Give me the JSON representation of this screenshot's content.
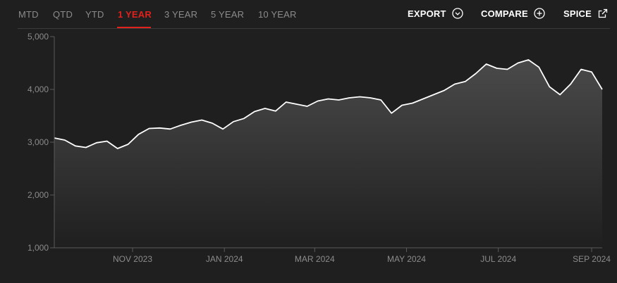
{
  "toolbar": {
    "tabs": [
      {
        "label": "MTD",
        "active": false
      },
      {
        "label": "QTD",
        "active": false
      },
      {
        "label": "YTD",
        "active": false
      },
      {
        "label": "1 YEAR",
        "active": true
      },
      {
        "label": "3 YEAR",
        "active": false
      },
      {
        "label": "5 YEAR",
        "active": false
      },
      {
        "label": "10 YEAR",
        "active": false
      }
    ],
    "actions": {
      "export_label": "EXPORT",
      "export_icon": "chevron-down-circle-icon",
      "compare_label": "COMPARE",
      "compare_icon": "plus-circle-icon",
      "spice_label": "SPICE",
      "spice_icon": "external-link-icon"
    },
    "accent_color": "#e0211c"
  },
  "chart_data": {
    "type": "area",
    "title": "",
    "xlabel": "",
    "ylabel": "",
    "ylim": [
      1000,
      5000
    ],
    "yticks": [
      1000,
      2000,
      3000,
      4000,
      5000
    ],
    "ytick_labels": [
      "1,000",
      "2,000",
      "3,000",
      "4,000",
      "5,000"
    ],
    "xtick_labels": [
      "NOV 2023",
      "JAN 2024",
      "MAR 2024",
      "MAY 2024",
      "JUL 2024",
      "SEP 2024"
    ],
    "xtick_dates": [
      "2023-11-01",
      "2024-01-01",
      "2024-03-01",
      "2024-05-01",
      "2024-07-01",
      "2024-09-01"
    ],
    "grid": false,
    "legend": "none",
    "line_color": "#ffffff",
    "fill_color": "#4a4a4a",
    "series": [
      {
        "x": [
          "2023-09-10",
          "2023-09-17",
          "2023-09-24",
          "2023-10-01",
          "2023-10-08",
          "2023-10-15",
          "2023-10-22",
          "2023-10-29",
          "2023-11-05",
          "2023-11-12",
          "2023-11-19",
          "2023-11-26",
          "2023-12-03",
          "2023-12-10",
          "2023-12-17",
          "2023-12-24",
          "2023-12-31",
          "2024-01-07",
          "2024-01-14",
          "2024-01-21",
          "2024-01-28",
          "2024-02-04",
          "2024-02-11",
          "2024-02-18",
          "2024-02-25",
          "2024-03-03",
          "2024-03-10",
          "2024-03-17",
          "2024-03-24",
          "2024-03-31",
          "2024-04-07",
          "2024-04-14",
          "2024-04-21",
          "2024-04-28",
          "2024-05-05",
          "2024-05-12",
          "2024-05-19",
          "2024-05-26",
          "2024-06-02",
          "2024-06-09",
          "2024-06-16",
          "2024-06-23",
          "2024-06-30",
          "2024-07-07",
          "2024-07-14",
          "2024-07-21",
          "2024-07-28",
          "2024-08-04",
          "2024-08-11",
          "2024-08-18",
          "2024-08-25",
          "2024-09-01",
          "2024-09-08"
        ],
        "y": [
          3080,
          3040,
          2930,
          2900,
          2990,
          3020,
          2880,
          2960,
          3150,
          3260,
          3270,
          3250,
          3320,
          3380,
          3420,
          3360,
          3250,
          3390,
          3450,
          3580,
          3640,
          3590,
          3760,
          3720,
          3680,
          3780,
          3820,
          3800,
          3840,
          3860,
          3840,
          3800,
          3550,
          3700,
          3740,
          3820,
          3900,
          3980,
          4100,
          4150,
          4300,
          4480,
          4400,
          4380,
          4500,
          4560,
          4420,
          4050,
          3900,
          4100,
          4380,
          4330,
          4000
        ]
      }
    ]
  }
}
